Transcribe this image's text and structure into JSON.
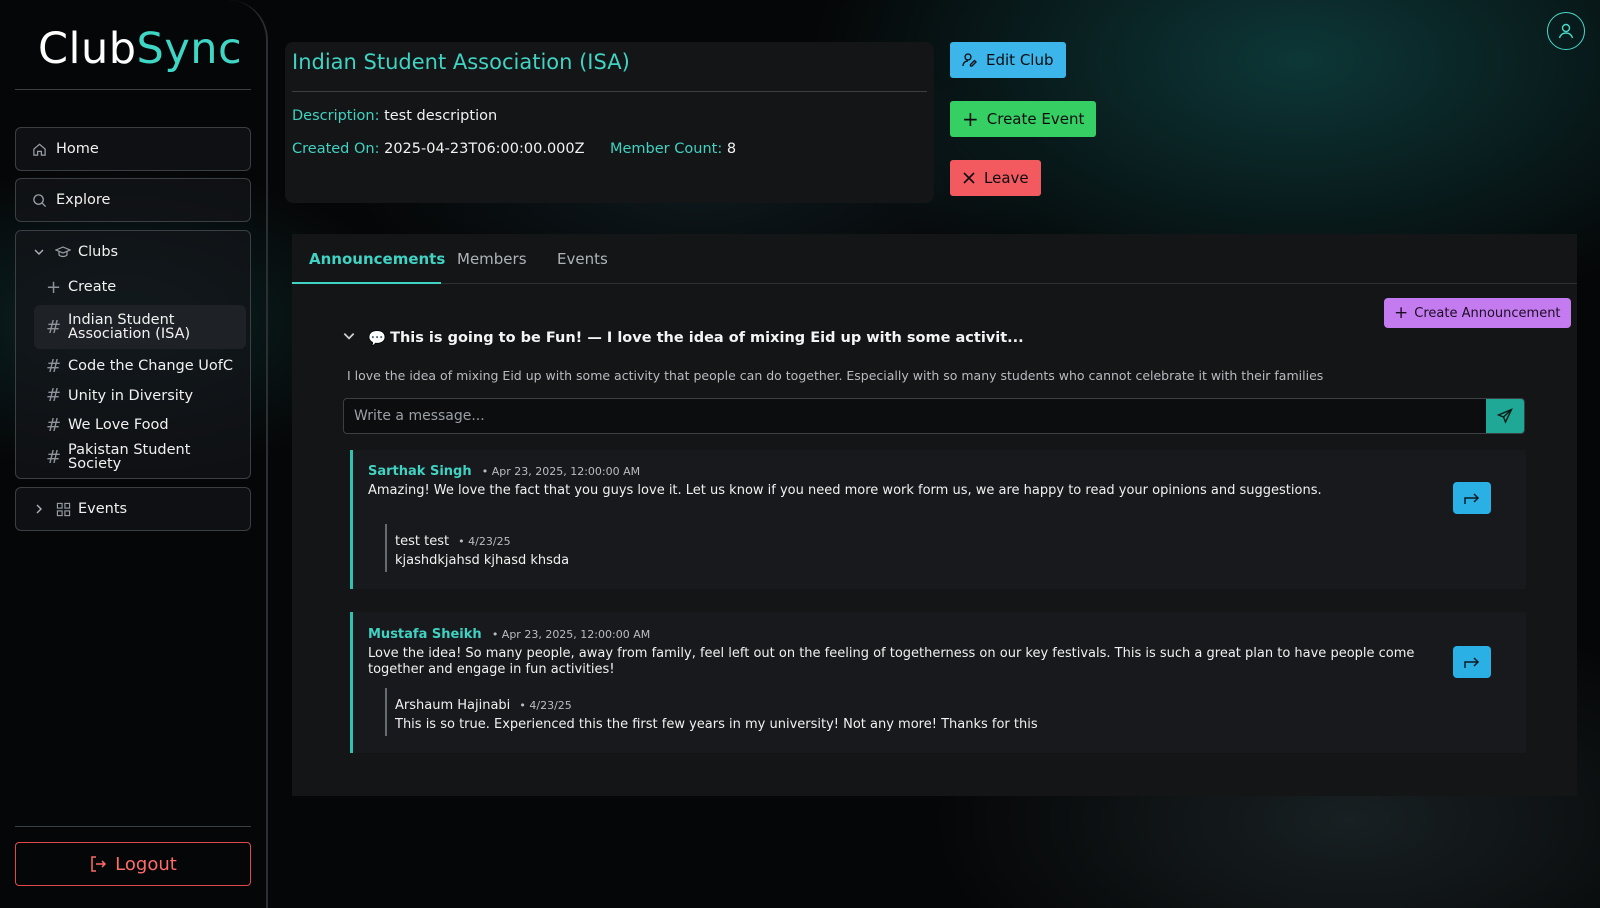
{
  "brand": {
    "part1": "Club",
    "part2": "Sync"
  },
  "sidebar": {
    "home": "Home",
    "explore": "Explore",
    "clubs": {
      "label": "Clubs",
      "create": "Create",
      "items": [
        {
          "label": "Indian Student Association (ISA)"
        },
        {
          "label": "Code the Change UofC"
        },
        {
          "label": "Unity in Diversity"
        },
        {
          "label": "We Love Food"
        },
        {
          "label": "Pakistan Student Society"
        }
      ]
    },
    "events": "Events",
    "logout": "Logout"
  },
  "club": {
    "title": "Indian Student Association (ISA)",
    "description_label": "Description:",
    "description": "test description",
    "created_label": "Created On:",
    "created": "2025-04-23T06:00:00.000Z",
    "members_label": "Member Count:",
    "members": "8"
  },
  "actions": {
    "edit": "Edit Club",
    "create_event": "Create Event",
    "leave": "Leave"
  },
  "tabs": [
    {
      "label": "Announcements"
    },
    {
      "label": "Members"
    },
    {
      "label": "Events"
    }
  ],
  "announcement": {
    "create_label": "Create Announcement",
    "emoji": "💬",
    "title": "This is going to be Fun! — I love the idea of mixing Eid up with some activit...",
    "body": "I love the idea of mixing Eid up with some activity that people can do together. Especially with so many students who cannot celebrate it with their families",
    "input_placeholder": "Write a message...",
    "comments": [
      {
        "name": "Sarthak Singh",
        "time": "• Apr 23, 2025, 12:00:00 AM",
        "text": "Amazing! We love the fact that you guys love it. Let us know if you need more work form us, we are happy to read your opinions and suggestions.",
        "reply": {
          "name": "test test",
          "time": "• 4/23/25",
          "text": "kjashdkjahsd kjhasd khsda"
        }
      },
      {
        "name": "Mustafa Sheikh",
        "time": "• Apr 23, 2025, 12:00:00 AM",
        "text": "Love the idea! So many people, away from family, feel left out on the feeling of togetherness on our key festivals. This is such a great plan to have people come together and engage in fun activities!",
        "reply": {
          "name": "Arshaum Hajinabi",
          "time": "• 4/23/25",
          "text": "This is so true. Experienced this the first few years in my university! Not any more! Thanks for this"
        }
      }
    ]
  },
  "colors": {
    "accent": "#40d2c2",
    "edit": "#3cb6ea",
    "create": "#36cf63",
    "leave": "#f25a5f",
    "announce": "#c57bf0"
  }
}
